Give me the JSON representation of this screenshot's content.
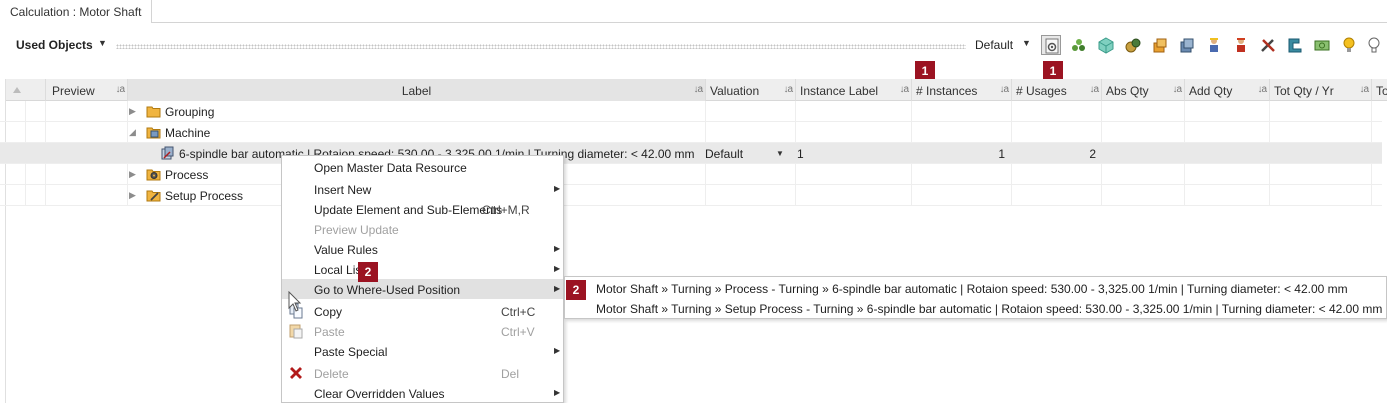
{
  "tab": {
    "title": "Calculation : Motor Shaft"
  },
  "toolbar": {
    "used_objects_label": "Used Objects",
    "view_label": "Default",
    "icons": [
      "document-settings-icon",
      "molecule-icon",
      "cube-icon",
      "parts-icon",
      "stack-icon",
      "layers-icon",
      "worker-icon",
      "operator-icon",
      "tools-icon",
      "fixture-icon",
      "money-icon",
      "bulb-icon",
      "lightbulb-outline-icon"
    ]
  },
  "grid": {
    "columns": [
      {
        "name": "Preview"
      },
      {
        "name": "Label"
      },
      {
        "name": "Valuation"
      },
      {
        "name": "Instance Label"
      },
      {
        "name": "# Instances"
      },
      {
        "name": "# Usages"
      },
      {
        "name": "Abs Qty"
      },
      {
        "name": "Add Qty"
      },
      {
        "name": "Tot Qty / Yr"
      },
      {
        "name": "To"
      }
    ],
    "rows": [
      {
        "label": "Grouping",
        "icon": "folder-icon",
        "expander": "▶"
      },
      {
        "label": "Machine",
        "icon": "machine-icon",
        "expander": "◢"
      },
      {
        "label": "6-spindle bar automatic | Rotaion speed: 530.00 - 3,325.00 1/min | Turning diameter:  < 42.00 mm",
        "icon": "machine-item-icon",
        "valuation": "Default",
        "instance_label": "1",
        "instances": "1",
        "usages": "2"
      },
      {
        "label": "Process",
        "icon": "process-gear-icon",
        "expander": "▶"
      },
      {
        "label": "Setup Process",
        "icon": "setup-process-icon",
        "expander": "▶"
      }
    ]
  },
  "badges": {
    "instances": "1",
    "usages": "1",
    "menu": "2",
    "submenu": "2"
  },
  "context_menu": {
    "items": [
      {
        "label": "Open Master Data Resource"
      },
      {
        "label": "Insert New",
        "submenu": true
      },
      {
        "label": "Update Element and Sub-Elements",
        "shortcut": "Ctrl+M,R"
      },
      {
        "label": "Preview Update",
        "disabled": true
      },
      {
        "label": "Value Rules",
        "submenu": true
      },
      {
        "label": "Local Lists",
        "submenu": true
      },
      {
        "label": "Go to Where-Used Position",
        "submenu": true,
        "highlighted": true
      },
      {
        "label": "Copy",
        "shortcut": "Ctrl+C",
        "icon": "copy-icon"
      },
      {
        "label": "Paste",
        "shortcut": "Ctrl+V",
        "icon": "paste-icon",
        "disabled": true
      },
      {
        "label": "Paste Special",
        "submenu": true
      },
      {
        "label": "Delete",
        "shortcut": "Del",
        "icon": "delete-x-icon",
        "disabled": true
      },
      {
        "label": "Clear Overridden Values",
        "submenu": true
      }
    ]
  },
  "where_used_submenu": {
    "items": [
      "Motor Shaft » Turning » Process - Turning » 6-spindle bar automatic | Rotaion speed: 530.00 - 3,325.00 1/min | Turning diameter:  < 42.00 mm",
      "Motor Shaft » Turning » Setup Process - Turning » 6-spindle bar automatic | Rotaion speed: 530.00 - 3,325.00 1/min | Turning diameter:  < 42.00 mm"
    ]
  },
  "colors": {
    "badge": "#9b1322",
    "header_bg": "#eeeeee",
    "selected_row": "#e9e9e9",
    "menu_hover": "#e1e1e1",
    "folder": "#f0b440",
    "delete": "#b21a1a"
  }
}
